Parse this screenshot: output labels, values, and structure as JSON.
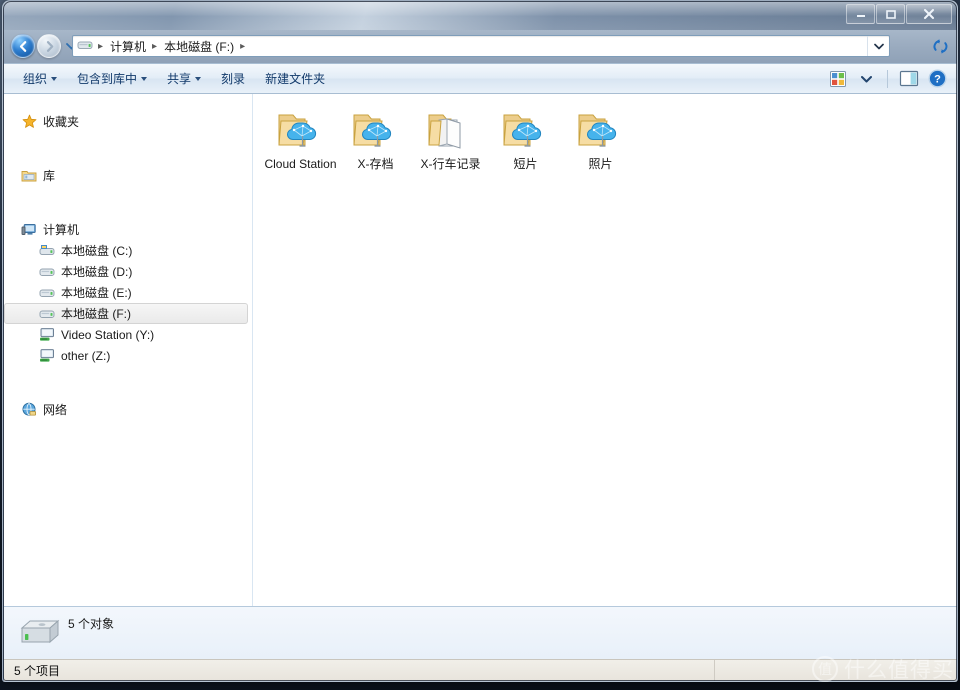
{
  "window": {
    "controls": {
      "minimize": "—",
      "maximize": "□",
      "close": "✕"
    }
  },
  "address_bar": {
    "back_icon": "back-arrow-icon",
    "forward_icon": "forward-arrow-icon",
    "history_icon": "history-dropdown-icon",
    "drive_icon": "drive-icon",
    "crumbs": [
      "计算机",
      "本地磁盘 (F:)"
    ],
    "separator": "▸",
    "dropdown_icon": "chevron-down-icon",
    "refresh_icon": "refresh-icon"
  },
  "toolbar": {
    "organize_label": "组织",
    "include_library_label": "包含到库中",
    "share_label": "共享",
    "burn_label": "刻录",
    "new_folder_label": "新建文件夹",
    "view_icon": "view-mode-icon",
    "view_caret_icon": "chevron-down-icon",
    "preview_pane_icon": "preview-pane-icon",
    "help_icon": "help-icon"
  },
  "sidebar": {
    "groups": [
      {
        "name": "favorites",
        "root": {
          "label": "收藏夹",
          "icon": "star-icon"
        },
        "children": []
      },
      {
        "name": "libraries",
        "root": {
          "label": "库",
          "icon": "library-icon"
        },
        "children": []
      },
      {
        "name": "computer",
        "root": {
          "label": "计算机",
          "icon": "computer-icon"
        },
        "children": [
          {
            "label": "本地磁盘 (C:)",
            "icon": "system-drive-icon",
            "selected": false
          },
          {
            "label": "本地磁盘 (D:)",
            "icon": "drive-icon",
            "selected": false
          },
          {
            "label": "本地磁盘 (E:)",
            "icon": "drive-icon",
            "selected": false
          },
          {
            "label": "本地磁盘 (F:)",
            "icon": "drive-icon",
            "selected": true
          },
          {
            "label": "Video Station (Y:)",
            "icon": "network-drive-icon",
            "selected": false
          },
          {
            "label": "other (Z:)",
            "icon": "network-drive-icon",
            "selected": false
          }
        ]
      },
      {
        "name": "network",
        "root": {
          "label": "网络",
          "icon": "network-icon"
        },
        "children": []
      }
    ]
  },
  "content": {
    "items": [
      {
        "label": "Cloud Station",
        "icon": "folder-cloud-icon"
      },
      {
        "label": "X-存档",
        "icon": "folder-cloud-icon"
      },
      {
        "label": "X-行车记录",
        "icon": "folder-open-icon"
      },
      {
        "label": "短片",
        "icon": "folder-cloud-icon"
      },
      {
        "label": "照片",
        "icon": "folder-cloud-icon"
      }
    ]
  },
  "details_pane": {
    "icon": "hard-drive-icon",
    "text": "5 个对象"
  },
  "status_bar": {
    "text": "5 个项目"
  },
  "watermark": {
    "badge": "值",
    "text": "什么值得买"
  },
  "colors": {
    "accent": "#2f7fd0",
    "folder": "#f2d08a",
    "cloud": "#3ba6e8",
    "selection": "#eaeaea",
    "toolbar_text": "#123a6b"
  }
}
